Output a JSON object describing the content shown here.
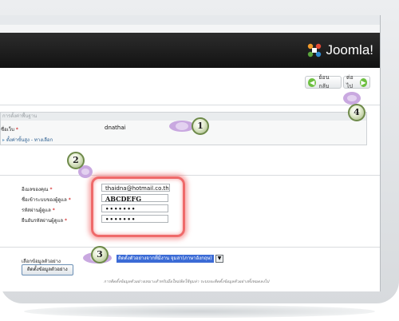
{
  "header": {
    "logo_text": "Joomla!"
  },
  "toolbar": {
    "back_label": "ย้อนกลับ",
    "next_label": "ต่อไป",
    "back_icon": "arrow-left-icon",
    "next_icon": "arrow-right-icon"
  },
  "basic_settings": {
    "legend": "การตั้งค่าพื้นฐาน",
    "site_name_label": "ชื่อเว็บ",
    "site_name_value": "dnathai",
    "advanced_toggle": "ตั้งค่าขั้นสูง - ทางเลือก"
  },
  "admin_account": {
    "email_label": "อีเมลของคุณ",
    "email_value": "thaidna@hotmail.co.th",
    "username_label": "ชื่อเข้าระบบของผู้ดูแล",
    "username_value": "ABCDEFG",
    "password_label": "รหัสผ่านผู้ดูแล",
    "password_value": "•••••••",
    "confirm_label": "ยืนยันรหัสผ่านผู้ดูแล",
    "confirm_value": "•••••••"
  },
  "sample_data": {
    "label": "เลือกข้อมูลตัวอย่าง",
    "selected_option": "ติดตั้งตัวอย่างจากที่มีงาน จุมล่า(ภาษาอังกฤษ)",
    "install_button": "ติดตั้งข้อมูลตัวอย่าง",
    "note": "การติดตั้งข้อมูลตัวอย่างเหมาะสำหรับมือใหม่หัดใช้จูมล่า ระบบจะติดตั้งข้อมูลตัวอย่างทั้งหมดลงไป"
  },
  "callouts": {
    "one": "1",
    "two": "2",
    "three": "3",
    "four": "4"
  },
  "colors": {
    "accent_green": "#6cbf3f",
    "highlight_red": "#ef6a6a",
    "header_dark": "#1e1e1e"
  }
}
